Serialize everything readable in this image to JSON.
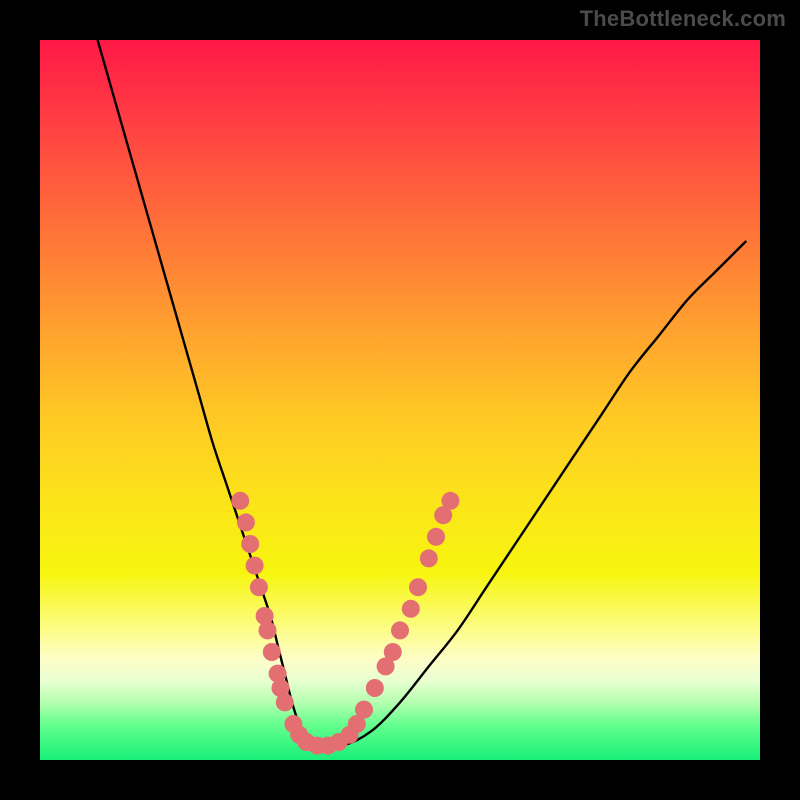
{
  "watermark": "TheBottleneck.com",
  "colors": {
    "curve": "#000000",
    "markers": "#e36f72",
    "background_frame": "#000000"
  },
  "chart_data": {
    "type": "line",
    "title": "",
    "xlabel": "",
    "ylabel": "",
    "xlim": [
      0,
      100
    ],
    "ylim": [
      0,
      100
    ],
    "grid": false,
    "legend": false,
    "series": [
      {
        "name": "bottleneck-curve",
        "x": [
          8,
          10,
          12,
          14,
          16,
          18,
          20,
          22,
          24,
          26,
          28,
          30,
          32,
          33,
          34,
          35,
          36,
          37,
          38,
          42,
          46,
          50,
          54,
          58,
          62,
          66,
          70,
          74,
          78,
          82,
          86,
          90,
          94,
          98
        ],
        "y": [
          100,
          93,
          86,
          79,
          72,
          65,
          58,
          51,
          44,
          38,
          32,
          26,
          20,
          16,
          12,
          8,
          5,
          3,
          2,
          2,
          4,
          8,
          13,
          18,
          24,
          30,
          36,
          42,
          48,
          54,
          59,
          64,
          68,
          72
        ]
      }
    ],
    "markers": [
      {
        "x": 27.8,
        "y": 36
      },
      {
        "x": 28.6,
        "y": 33
      },
      {
        "x": 29.2,
        "y": 30
      },
      {
        "x": 29.8,
        "y": 27
      },
      {
        "x": 30.4,
        "y": 24
      },
      {
        "x": 31.2,
        "y": 20
      },
      {
        "x": 31.6,
        "y": 18
      },
      {
        "x": 32.2,
        "y": 15
      },
      {
        "x": 33.0,
        "y": 12
      },
      {
        "x": 33.4,
        "y": 10
      },
      {
        "x": 34.0,
        "y": 8
      },
      {
        "x": 35.2,
        "y": 5
      },
      {
        "x": 36.0,
        "y": 3.5
      },
      {
        "x": 37.0,
        "y": 2.5
      },
      {
        "x": 38.5,
        "y": 2
      },
      {
        "x": 40.0,
        "y": 2
      },
      {
        "x": 41.5,
        "y": 2.5
      },
      {
        "x": 43.0,
        "y": 3.5
      },
      {
        "x": 44.0,
        "y": 5
      },
      {
        "x": 45.0,
        "y": 7
      },
      {
        "x": 46.5,
        "y": 10
      },
      {
        "x": 48.0,
        "y": 13
      },
      {
        "x": 49.0,
        "y": 15
      },
      {
        "x": 50.0,
        "y": 18
      },
      {
        "x": 51.5,
        "y": 21
      },
      {
        "x": 52.5,
        "y": 24
      },
      {
        "x": 54.0,
        "y": 28
      },
      {
        "x": 55.0,
        "y": 31
      },
      {
        "x": 56.0,
        "y": 34
      },
      {
        "x": 57.0,
        "y": 36
      }
    ]
  }
}
